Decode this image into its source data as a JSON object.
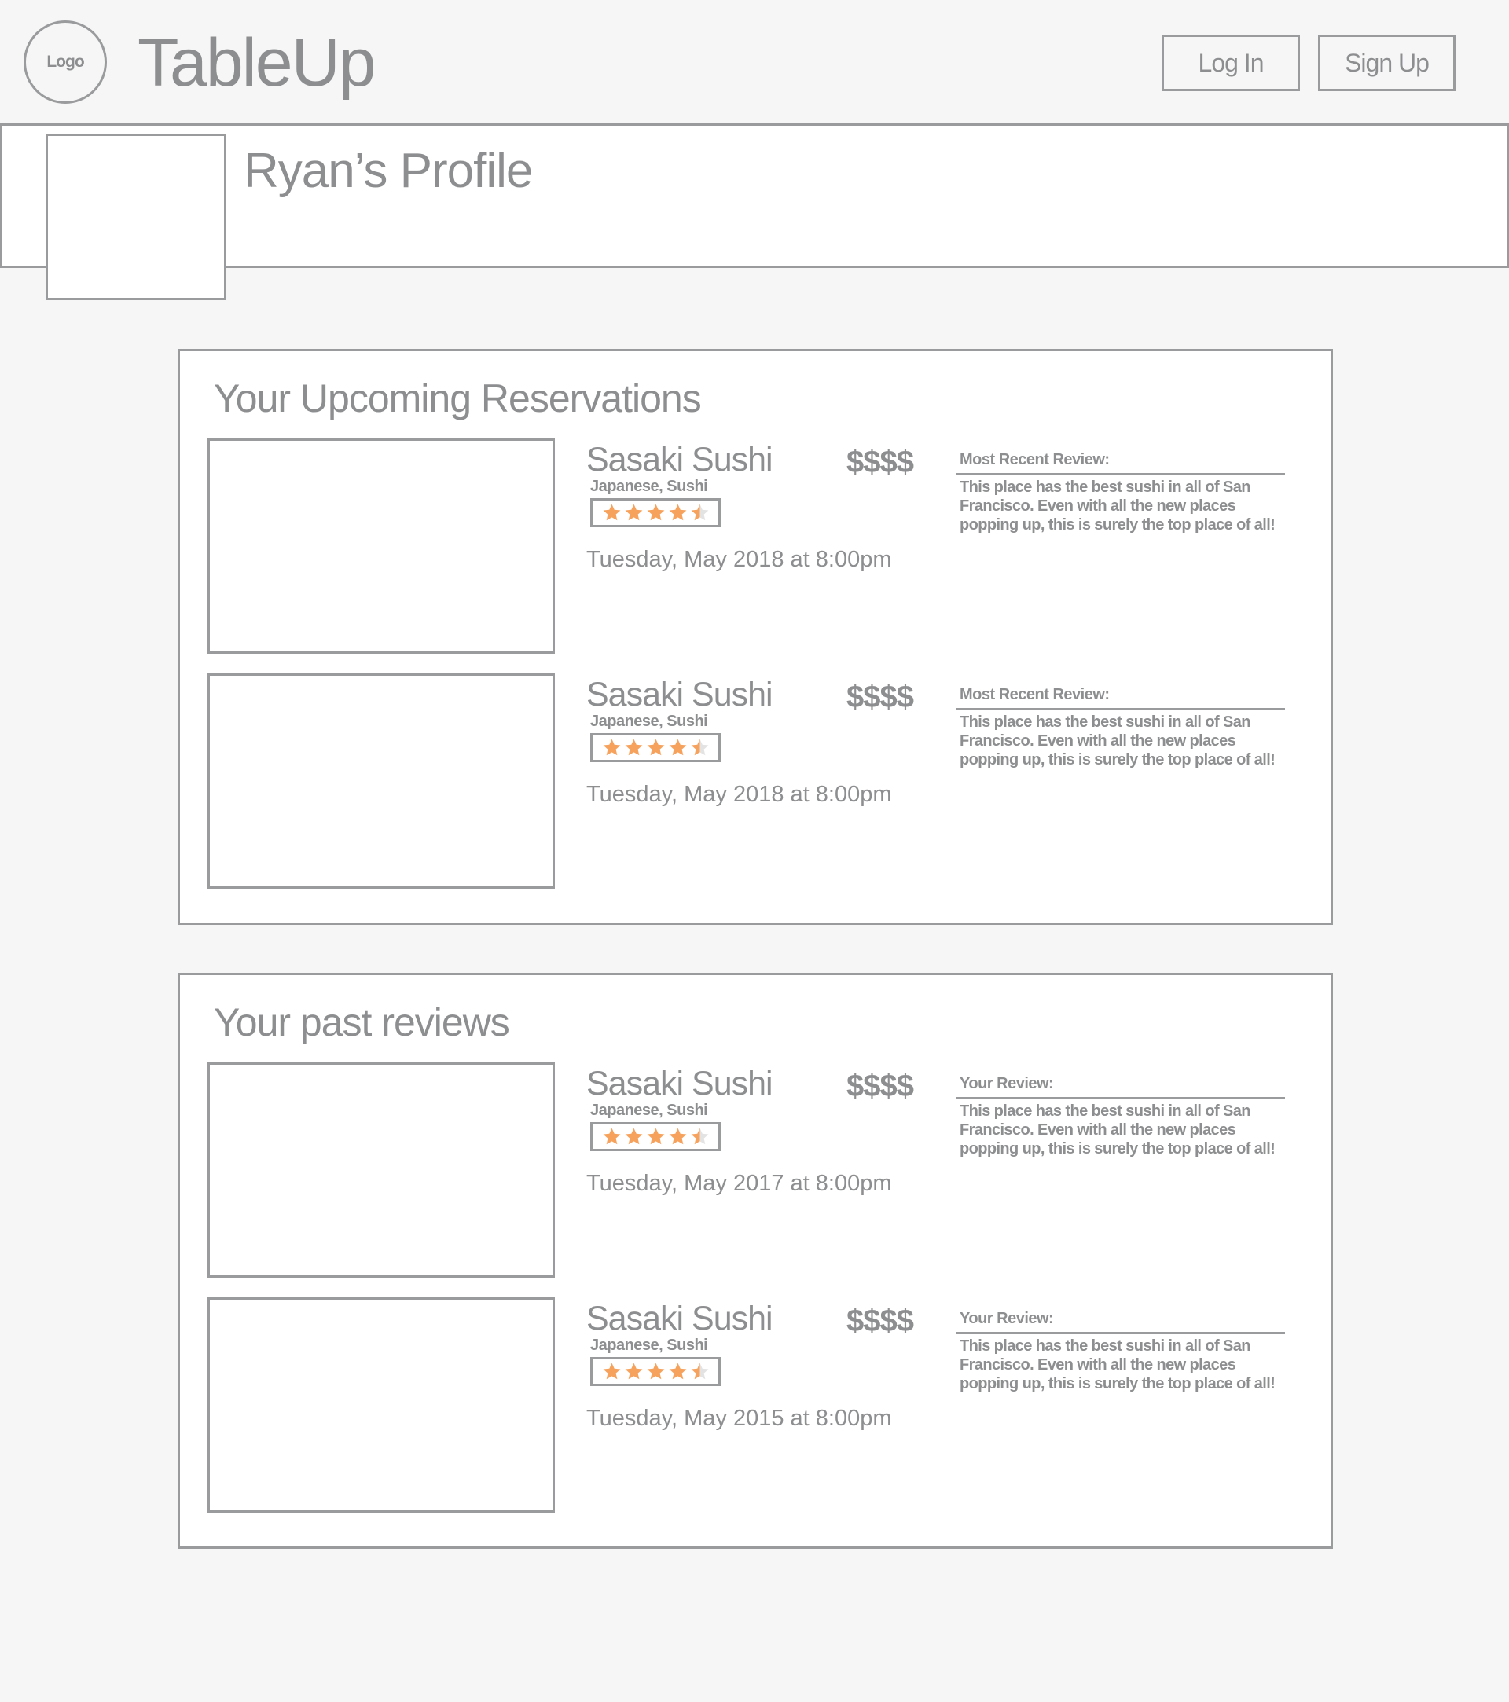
{
  "header": {
    "logo_text": "Logo",
    "app_title": "TableUp",
    "login_label": "Log In",
    "signup_label": "Sign Up"
  },
  "profile": {
    "name": "Ryan’s Profile"
  },
  "upcoming": {
    "title": "Your Upcoming Reservations",
    "items": [
      {
        "name": "Sasaki Sushi",
        "price": "$$$$",
        "cuisine": "Japanese, Sushi",
        "rating": 4.5,
        "datetime": "Tuesday, May 2018 at 8:00pm",
        "review_label": "Most Recent Review:",
        "review_text": "This place has the best sushi in all of San Francisco. Even with all the new places popping up, this is surely the top place of all!"
      },
      {
        "name": "Sasaki Sushi",
        "price": "$$$$",
        "cuisine": "Japanese, Sushi",
        "rating": 4.5,
        "datetime": "Tuesday, May 2018 at 8:00pm",
        "review_label": "Most Recent Review:",
        "review_text": "This place has the best sushi in all of San Francisco. Even with all the new places popping up, this is surely the top place of all!"
      }
    ]
  },
  "past": {
    "title": "Your past reviews",
    "items": [
      {
        "name": "Sasaki Sushi",
        "price": "$$$$",
        "cuisine": "Japanese, Sushi",
        "rating": 4.5,
        "datetime": "Tuesday, May 2017 at 8:00pm",
        "review_label": "Your Review:",
        "review_text": "This place has the best sushi in all of San Francisco. Even with all the new places popping up, this is surely the top place of all!"
      },
      {
        "name": "Sasaki Sushi",
        "price": "$$$$",
        "cuisine": "Japanese, Sushi",
        "rating": 4.5,
        "datetime": "Tuesday, May 2015 at 8:00pm",
        "review_label": "Your Review:",
        "review_text": "This place has the best sushi in all of San Francisco. Even with all the new places popping up, this is surely the top place of all!"
      }
    ]
  },
  "colors": {
    "star_filled": "#f7a25c",
    "star_empty": "#e3e3e3",
    "border": "#9a9b9d",
    "text": "#8d8e90",
    "background": "#f6f6f6"
  }
}
